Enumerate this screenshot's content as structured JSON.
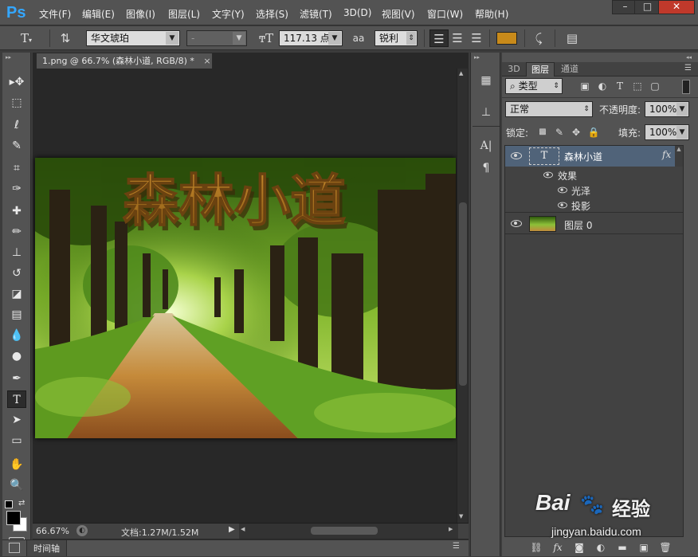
{
  "app": {
    "logo": "Ps"
  },
  "menu": [
    {
      "label": "文件(F)"
    },
    {
      "label": "编辑(E)"
    },
    {
      "label": "图像(I)"
    },
    {
      "label": "图层(L)"
    },
    {
      "label": "文字(Y)"
    },
    {
      "label": "选择(S)"
    },
    {
      "label": "滤镜(T)"
    },
    {
      "label": "3D(D)"
    },
    {
      "label": "视图(V)"
    },
    {
      "label": "窗口(W)"
    },
    {
      "label": "帮助(H)"
    }
  ],
  "window_controls": {
    "minimize": "–",
    "maximize": "□",
    "close": "✕"
  },
  "options": {
    "font_family": "华文琥珀",
    "font_style": "-",
    "font_size": "117.13 点",
    "aa_icon": "aa",
    "anti_alias": "锐利",
    "text_color": "#c88a1a"
  },
  "tools": [
    {
      "icon": "move-icon",
      "glyph": "▸✥"
    },
    {
      "icon": "marquee-icon",
      "glyph": "⬚"
    },
    {
      "icon": "lasso-icon",
      "glyph": "ℓ"
    },
    {
      "icon": "quick-select-icon",
      "glyph": "✎"
    },
    {
      "icon": "crop-icon",
      "glyph": "⌗"
    },
    {
      "icon": "eyedropper-icon",
      "glyph": "✑"
    },
    {
      "icon": "healing-icon",
      "glyph": "✚"
    },
    {
      "icon": "brush-icon",
      "glyph": "✏"
    },
    {
      "icon": "stamp-icon",
      "glyph": "⊥"
    },
    {
      "icon": "history-brush-icon",
      "glyph": "↺"
    },
    {
      "icon": "eraser-icon",
      "glyph": "◪"
    },
    {
      "icon": "gradient-icon",
      "glyph": "▤"
    },
    {
      "icon": "blur-icon",
      "glyph": "💧"
    },
    {
      "icon": "dodge-icon",
      "glyph": "●"
    },
    {
      "icon": "pen-icon",
      "glyph": "✒"
    },
    {
      "icon": "type-icon",
      "glyph": "T"
    },
    {
      "icon": "path-select-icon",
      "glyph": "➤"
    },
    {
      "icon": "rectangle-shape-icon",
      "glyph": "▭"
    },
    {
      "icon": "hand-icon",
      "glyph": "✋"
    },
    {
      "icon": "zoom-icon",
      "glyph": "🔍"
    }
  ],
  "document": {
    "tab_title": "1.png @ 66.7% (森林小道, RGB/8) *",
    "tab_close": "×",
    "canvas_text": "森林小道"
  },
  "status": {
    "zoom": "66.67%",
    "doc_info": "文档:1.27M/1.52M"
  },
  "bottom_panel": {
    "label": "时间轴"
  },
  "panel": {
    "tabs": [
      {
        "label": "3D"
      },
      {
        "label": "图层"
      },
      {
        "label": "通道"
      }
    ],
    "filter_kind": "类型",
    "blend_mode": "正常",
    "opacity_label": "不透明度:",
    "opacity_value": "100%",
    "lock_label": "锁定:",
    "fill_label": "填充:",
    "fill_value": "100%",
    "layers": [
      {
        "name": "森林小道",
        "fx": "fx",
        "effects_label": "效果",
        "effects": [
          "光泽",
          "投影"
        ]
      },
      {
        "name": "图层 0"
      }
    ]
  },
  "watermark": {
    "brand_left": "Bai",
    "brand_right": "经验",
    "url": "jingyan.baidu.com"
  }
}
